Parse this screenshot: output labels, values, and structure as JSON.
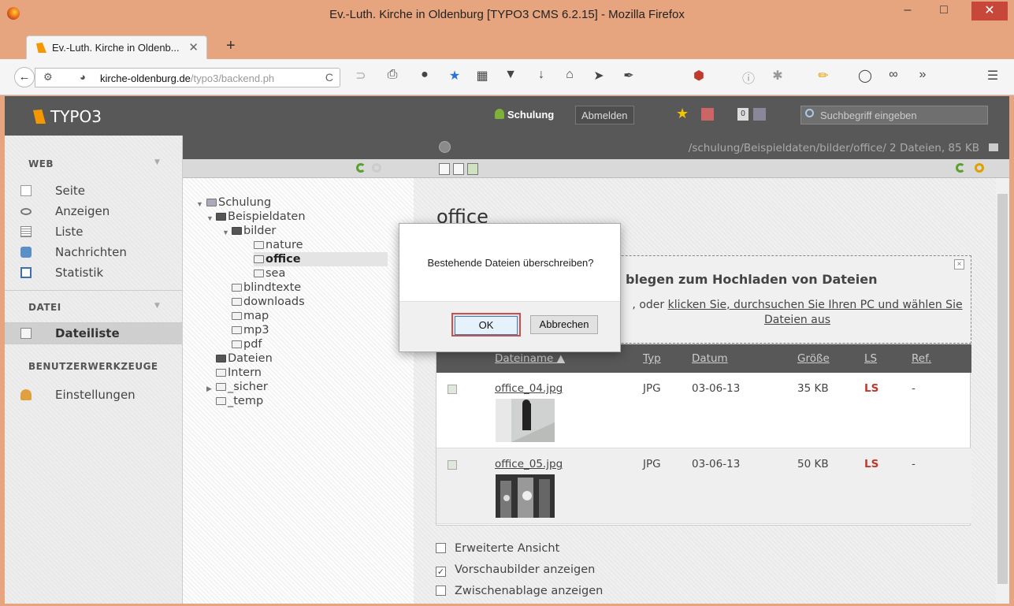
{
  "window": {
    "title": "Ev.-Luth. Kirche in Oldenburg [TYPO3 CMS 6.2.15] - Mozilla Firefox",
    "minimize": "–",
    "maximize": "□",
    "close": "✕"
  },
  "browser": {
    "tab_title": "Ev.-Luth. Kirche in Oldenb...",
    "tab_close": "✕",
    "new_tab": "+",
    "url_domain": "kirche-oldenburg.de",
    "url_path": "/typo3/backend.ph",
    "reload": "C",
    "overflow": "»",
    "menu": "☰"
  },
  "typo3": {
    "logo": "TYPO3",
    "user": "Schulung",
    "logout": "Abmelden",
    "badge_count": "0",
    "search_placeholder": "Suchbegriff eingeben"
  },
  "modules": {
    "web_label": "WEB",
    "web_items": [
      "Seite",
      "Anzeigen",
      "Liste",
      "Nachrichten",
      "Statistik"
    ],
    "datei_label": "DATEI",
    "datei_items": [
      "Dateiliste"
    ],
    "tools_label": "BENUTZERWERKZEUGE",
    "tools_items": [
      "Einstellungen"
    ]
  },
  "tree": {
    "nodes": [
      "Schulung",
      "Beispieldaten",
      "bilder",
      "nature",
      "office",
      "sea",
      "blindtexte",
      "downloads",
      "map",
      "mp3",
      "pdf",
      "Dateien",
      "Intern",
      "_sicher",
      "_temp"
    ],
    "selected": "office"
  },
  "content": {
    "path": "/schulung/Beispieldaten/bilder/office/ 2 Dateien, 85 KB",
    "heading": "office",
    "dropzone_title": "blegen zum Hochladen von Dateien",
    "dropzone_text_prefix": ", oder",
    "dropzone_link": "klicken Sie, durchsuchen Sie Ihren PC und wählen Sie Dateien aus",
    "dropzone_close": "×",
    "columns": [
      "Dateiname ▲",
      "Typ",
      "Datum",
      "Größe",
      "LS",
      "Ref."
    ],
    "files": [
      {
        "name": "office_04.jpg",
        "type": "JPG",
        "date": "03-06-13",
        "size": "35 KB",
        "ls": "LS",
        "ref": "-"
      },
      {
        "name": "office_05.jpg",
        "type": "JPG",
        "date": "03-06-13",
        "size": "50 KB",
        "ls": "LS",
        "ref": "-"
      }
    ],
    "options": [
      {
        "label": "Erweiterte Ansicht",
        "checked": false
      },
      {
        "label": "Vorschaubilder anzeigen",
        "checked": true
      },
      {
        "label": "Zwischenablage anzeigen",
        "checked": false
      }
    ]
  },
  "dialog": {
    "message": "Bestehende Dateien überschreiben?",
    "ok": "OK",
    "cancel": "Abbrechen"
  },
  "colors": {
    "window_chrome": "#e6a47f",
    "typo3_bar": "#585858",
    "brand_orange": "#f49700",
    "ls_red": "#c0392b"
  }
}
